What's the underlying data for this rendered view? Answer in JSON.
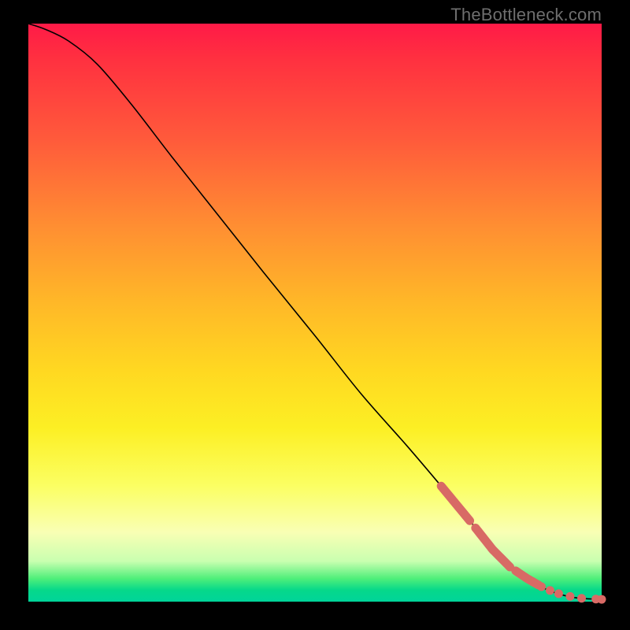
{
  "watermark": "TheBottleneck.com",
  "colors": {
    "highlight": "#d86a65",
    "curve": "#000000"
  },
  "chart_data": {
    "type": "line",
    "title": "",
    "xlabel": "",
    "ylabel": "",
    "xlim": [
      0,
      100
    ],
    "ylim": [
      0,
      100
    ],
    "grid": false,
    "series": [
      {
        "name": "curve",
        "x": [
          0,
          3,
          7,
          12,
          18,
          25,
          33,
          41,
          50,
          58,
          66,
          72,
          77,
          81,
          84,
          87,
          90,
          93,
          96,
          100
        ],
        "y": [
          100,
          99,
          97,
          93,
          86,
          77,
          67,
          57,
          46,
          36,
          27,
          20,
          14,
          9,
          6,
          4,
          2.3,
          1.2,
          0.6,
          0.4
        ]
      }
    ],
    "highlight_segments": [
      {
        "x_start": 72,
        "x_end": 77
      },
      {
        "x_start": 78,
        "x_end": 84
      },
      {
        "x_start": 85,
        "x_end": 89
      }
    ],
    "flat_dots_x": [
      88,
      89.5,
      91,
      92.5,
      94.5,
      96.5,
      99,
      100
    ]
  }
}
